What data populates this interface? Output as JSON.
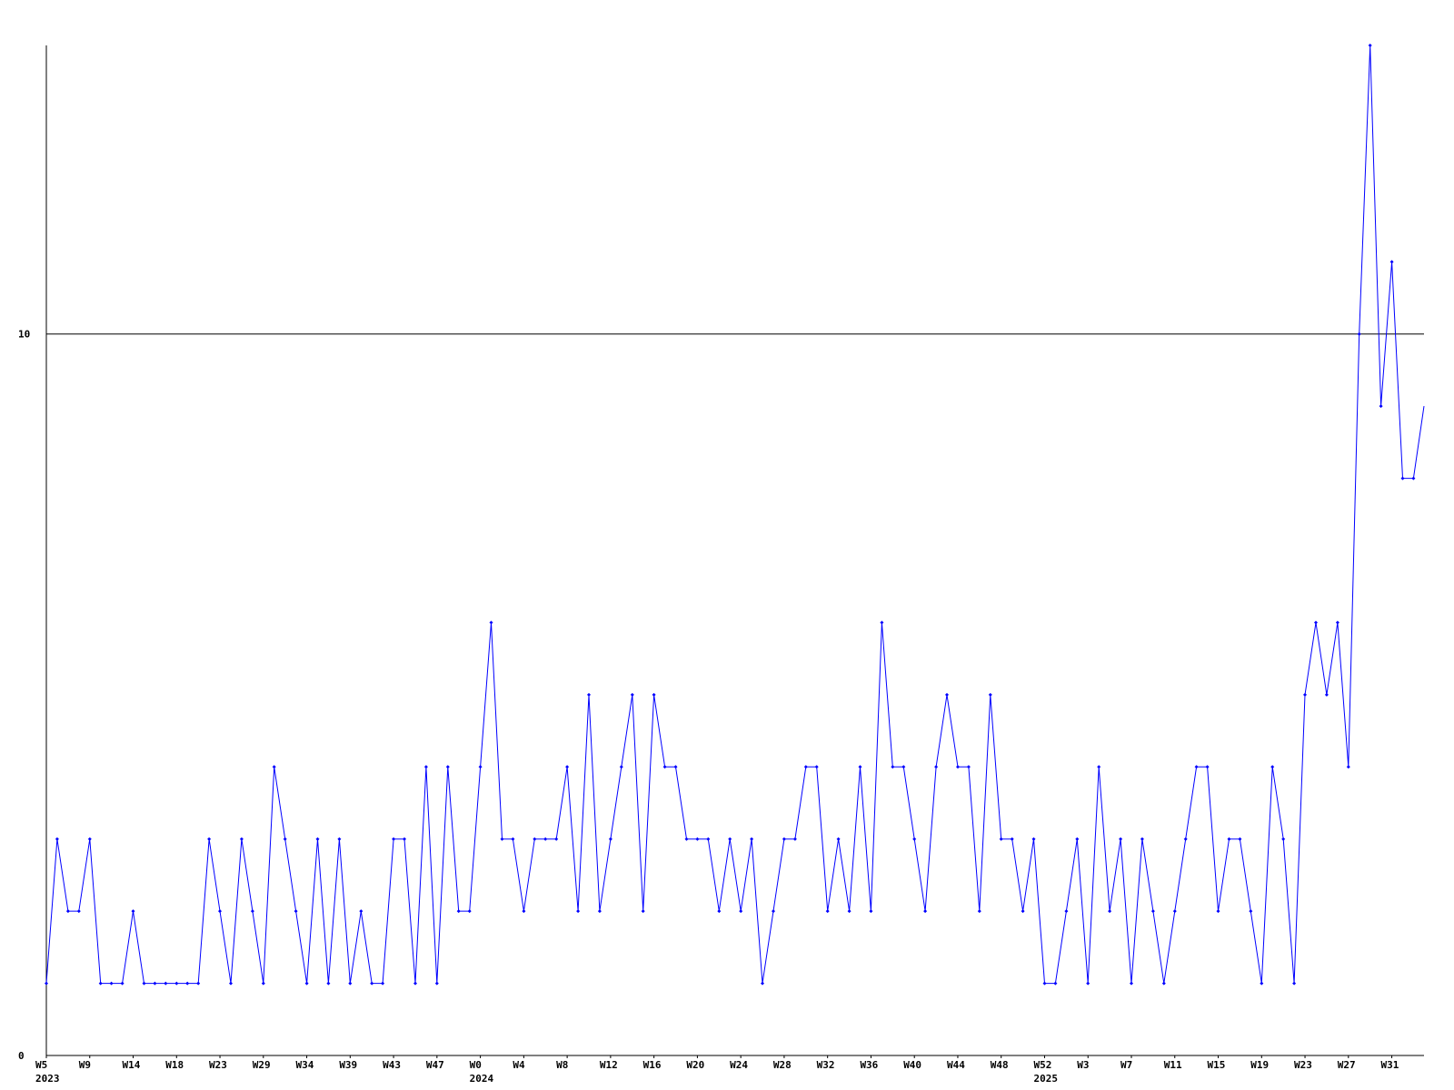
{
  "chart_data": {
    "type": "line",
    "title": "",
    "xlabel": "",
    "ylabel": "",
    "ylim": [
      0,
      14
    ],
    "y_ticks": [
      {
        "value": 0,
        "label": "0"
      },
      {
        "value": 10,
        "label": "10"
      }
    ],
    "reference_lines": [
      10
    ],
    "grid": false,
    "legend": "none",
    "colors": {
      "line": "#0000ff",
      "axis": "#000000",
      "reference": "#000000"
    },
    "x_ticks": [
      {
        "index": 0,
        "label": "W5",
        "year": "2023"
      },
      {
        "index": 4,
        "label": "W9"
      },
      {
        "index": 8,
        "label": "W14"
      },
      {
        "index": 12,
        "label": "W18"
      },
      {
        "index": 16,
        "label": "W23"
      },
      {
        "index": 20,
        "label": "W29"
      },
      {
        "index": 24,
        "label": "W34"
      },
      {
        "index": 28,
        "label": "W39"
      },
      {
        "index": 32,
        "label": "W43"
      },
      {
        "index": 36,
        "label": "W47"
      },
      {
        "index": 40,
        "label": "W0",
        "year": "2024"
      },
      {
        "index": 44,
        "label": "W4"
      },
      {
        "index": 48,
        "label": "W8"
      },
      {
        "index": 52,
        "label": "W12"
      },
      {
        "index": 56,
        "label": "W16"
      },
      {
        "index": 60,
        "label": "W20"
      },
      {
        "index": 64,
        "label": "W24"
      },
      {
        "index": 68,
        "label": "W28"
      },
      {
        "index": 72,
        "label": "W32"
      },
      {
        "index": 76,
        "label": "W36"
      },
      {
        "index": 80,
        "label": "W40"
      },
      {
        "index": 84,
        "label": "W44"
      },
      {
        "index": 88,
        "label": "W48"
      },
      {
        "index": 92,
        "label": "W52",
        "year": "2025"
      },
      {
        "index": 96,
        "label": "W3"
      },
      {
        "index": 100,
        "label": "W7"
      },
      {
        "index": 104,
        "label": "W11"
      },
      {
        "index": 108,
        "label": "W15"
      },
      {
        "index": 112,
        "label": "W19"
      },
      {
        "index": 116,
        "label": "W23"
      },
      {
        "index": 120,
        "label": "W27"
      },
      {
        "index": 124,
        "label": "W31"
      }
    ],
    "series": [
      {
        "values": [
          1,
          3,
          2,
          2,
          3,
          1,
          1,
          1,
          2,
          1,
          1,
          1,
          1,
          1,
          1,
          3,
          2,
          1,
          3,
          2,
          1,
          4,
          3,
          2,
          1,
          3,
          1,
          3,
          1,
          2,
          1,
          1,
          3,
          3,
          1,
          4,
          1,
          4,
          2,
          2,
          4,
          6,
          3,
          3,
          2,
          3,
          3,
          3,
          4,
          2,
          5,
          2,
          3,
          4,
          5,
          2,
          5,
          4,
          4,
          3,
          3,
          3,
          2,
          3,
          2,
          3,
          1,
          2,
          3,
          3,
          4,
          4,
          2,
          3,
          2,
          4,
          2,
          6,
          4,
          4,
          3,
          2,
          4,
          5,
          4,
          4,
          2,
          5,
          3,
          3,
          2,
          3,
          1,
          1,
          2,
          3,
          1,
          4,
          2,
          3,
          1,
          3,
          2,
          1,
          2,
          3,
          4,
          4,
          2,
          3,
          3,
          2,
          1,
          4,
          3,
          1,
          5,
          6,
          5,
          6,
          4,
          10,
          14,
          9,
          11,
          8,
          8,
          9
        ]
      }
    ]
  }
}
